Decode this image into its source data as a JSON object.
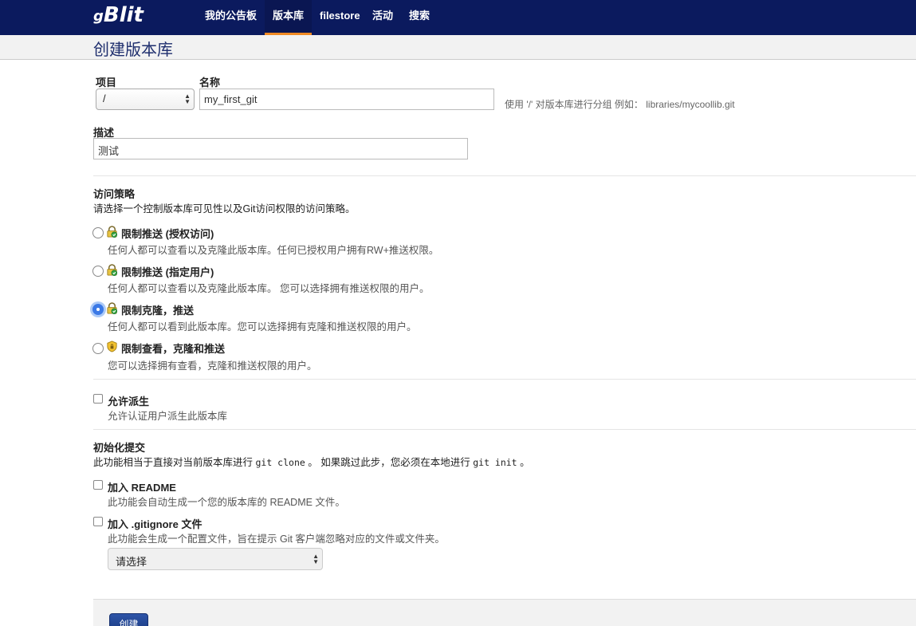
{
  "brand": {
    "name": "Blit",
    "prefix": "g"
  },
  "nav": {
    "items": [
      {
        "label": "我的公告板"
      },
      {
        "label": "版本库"
      },
      {
        "label": "filestore"
      },
      {
        "label": "活动"
      },
      {
        "label": "搜索"
      }
    ],
    "active": "版本库"
  },
  "page_title": "创建版本库",
  "form": {
    "project_label": "项目",
    "project_value": "/",
    "name_label": "名称",
    "name_value": "my_first_git",
    "name_hint": "使用 '/' 对版本库进行分组 例如： libraries/mycoollib.git",
    "desc_label": "描述",
    "desc_value": "测试"
  },
  "access": {
    "title": "访问策略",
    "description": "请选择一个控制版本库可见性以及Git访问权限的访问策略。",
    "options": [
      {
        "title": "限制推送 (授权访问)",
        "desc": "任何人都可以查看以及克隆此版本库。任何已授权用户拥有RW+推送权限。",
        "icon": "lock-green-icon",
        "checked": false
      },
      {
        "title": "限制推送 (指定用户)",
        "desc": "任何人都可以查看以及克隆此版本库。 您可以选择拥有推送权限的用户。",
        "icon": "lock-green-icon",
        "checked": false
      },
      {
        "title": "限制克隆，推送",
        "desc": "任何人都可以看到此版本库。您可以选择拥有克隆和推送权限的用户。",
        "icon": "lock-green-icon",
        "checked": true
      },
      {
        "title": "限制查看，克隆和推送",
        "desc": "您可以选择拥有查看，克隆和推送权限的用户。",
        "icon": "shield-icon",
        "checked": false
      }
    ]
  },
  "fork": {
    "title": "允许派生",
    "desc": "允许认证用户派生此版本库"
  },
  "init": {
    "title": "初始化提交",
    "desc_pre": "此功能相当于直接对当前版本库进行 ",
    "code1": "git clone",
    "desc_mid": " 。 如果跳过此步，您必须在本地进行 ",
    "code2": "git init",
    "desc_post": " 。",
    "readme_title": "加入 README",
    "readme_desc": "此功能会自动生成一个您的版本库的 README 文件。",
    "gitignore_title": "加入 .gitignore 文件",
    "gitignore_desc": "此功能会生成一个配置文件，旨在提示 Git 客户端忽略对应的文件或文件夹。",
    "gitignore_select": "请选择"
  },
  "submit_label": "创建"
}
